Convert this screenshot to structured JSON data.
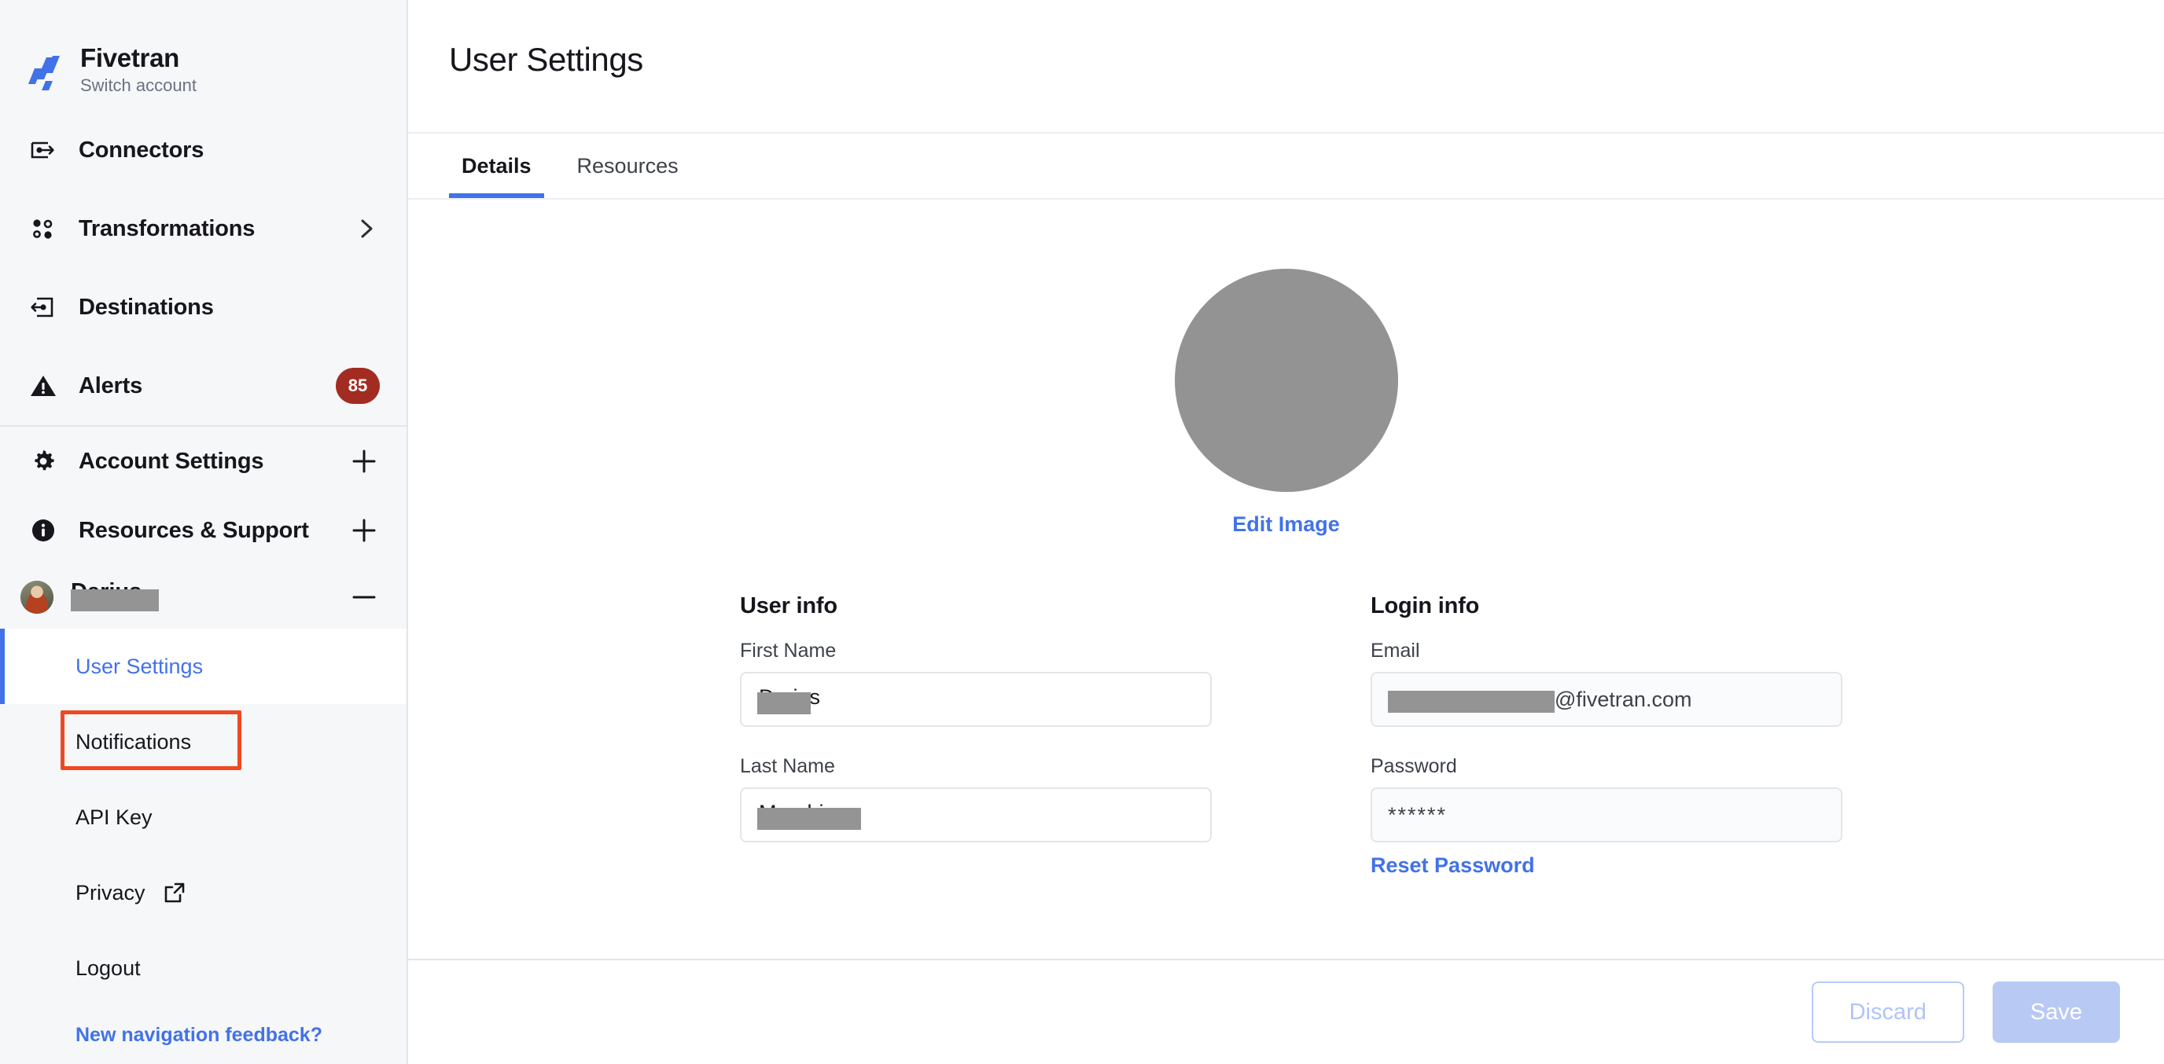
{
  "brand": {
    "name": "Fivetran",
    "switch_account": "Switch account",
    "logo_icon": "fivetran-logo",
    "logo_color": "#4272e8"
  },
  "sidebar": {
    "nav_items": [
      {
        "label": "Connectors",
        "icon": "connectors-icon",
        "badge": null,
        "trailing": null
      },
      {
        "label": "Transformations",
        "icon": "transformations-icon",
        "badge": null,
        "trailing": "chevron-right-icon"
      },
      {
        "label": "Destinations",
        "icon": "destinations-icon",
        "badge": null,
        "trailing": null
      },
      {
        "label": "Alerts",
        "icon": "alert-triangle-icon",
        "badge": "85",
        "trailing": null
      }
    ],
    "section_items": [
      {
        "label": "Account Settings",
        "icon": "gear-icon",
        "trailing": "plus-icon"
      },
      {
        "label": "Resources & Support",
        "icon": "info-icon",
        "trailing": "plus-icon"
      }
    ],
    "profile": {
      "name_redacted": true,
      "name_ghost": "Darius",
      "trailing": "minus-icon",
      "avatar_icon": "user-avatar"
    },
    "sub_items": [
      {
        "label": "User Settings",
        "active": true,
        "external": false
      },
      {
        "label": "Notifications",
        "active": false,
        "external": false
      },
      {
        "label": "API Key",
        "active": false,
        "external": false
      },
      {
        "label": "Privacy",
        "active": false,
        "external": true
      },
      {
        "label": "Logout",
        "active": false,
        "external": false
      }
    ],
    "feedback_link": "New navigation feedback?",
    "badge_color": "#a32c22",
    "active_color": "#4272e8"
  },
  "annotation": {
    "target": "User Settings",
    "color": "#f04822"
  },
  "header": {
    "title": "User Settings"
  },
  "tabs": [
    {
      "label": "Details",
      "active": true
    },
    {
      "label": "Resources",
      "active": false
    }
  ],
  "avatar": {
    "edit_label": "Edit Image",
    "redacted": true
  },
  "form": {
    "user_info": {
      "title": "User info",
      "fields": [
        {
          "label": "First Name",
          "value_redacted": true,
          "value_ghost": "Darius",
          "disabled": false,
          "redact_width": 68
        },
        {
          "label": "Last Name",
          "value_redacted": true,
          "value_ghost": "Marubi",
          "disabled": false,
          "redact_width": 132
        }
      ]
    },
    "login_info": {
      "title": "Login info",
      "fields": [
        {
          "label": "Email",
          "value_suffix": "@fivetran.com",
          "value_redacted": true,
          "disabled": true,
          "redact_width": 212
        },
        {
          "label": "Password",
          "value": "******",
          "value_redacted": false,
          "disabled": true
        }
      ],
      "reset_link": "Reset Password"
    }
  },
  "footer": {
    "discard_label": "Discard",
    "save_label": "Save",
    "disabled": true
  }
}
